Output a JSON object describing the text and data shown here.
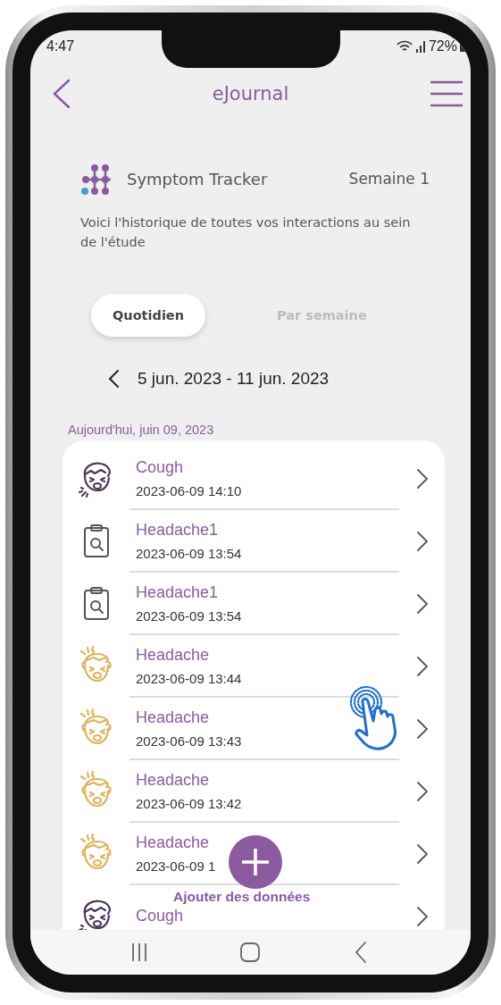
{
  "status_bar": {
    "time": "4:47",
    "battery": "72%"
  },
  "header": {
    "title": "eJournal"
  },
  "tracker": {
    "name": "Symptom Tracker",
    "week": "Semaine 1",
    "description": "Voici l'historique de toutes vos interactions au sein de l'étude"
  },
  "tabs": [
    {
      "label": "Quotidien",
      "selected": true
    },
    {
      "label": "Par semaine",
      "selected": false
    }
  ],
  "date_range": "5 jun. 2023 - 11 jun. 2023",
  "section_label": "Aujourd'hui, juin 09, 2023",
  "entries": [
    {
      "kind": "cough",
      "title": "Cough",
      "timestamp": "2023-06-09 14:10"
    },
    {
      "kind": "survey",
      "title": "Headache1",
      "timestamp": "2023-06-09 13:54"
    },
    {
      "kind": "survey",
      "title": "Headache1",
      "timestamp": "2023-06-09 13:54"
    },
    {
      "kind": "headache",
      "title": "Headache",
      "timestamp": "2023-06-09 13:44"
    },
    {
      "kind": "headache",
      "title": "Headache",
      "timestamp": "2023-06-09 13:43"
    },
    {
      "kind": "headache",
      "title": "Headache",
      "timestamp": "2023-06-09 13:42"
    },
    {
      "kind": "headache",
      "title": "Headache",
      "timestamp": "2023-06-09 1"
    },
    {
      "kind": "cough",
      "title": "Cough"
    }
  ],
  "add_button": {
    "label": "Ajouter des données"
  }
}
